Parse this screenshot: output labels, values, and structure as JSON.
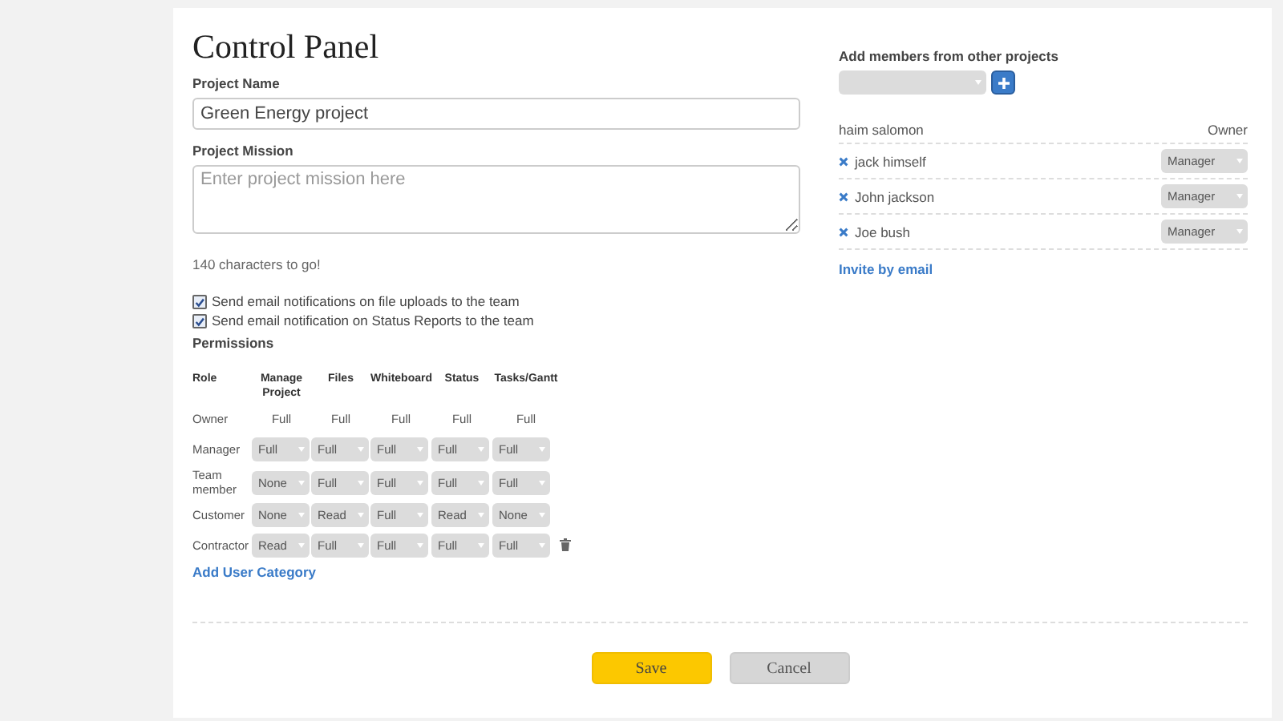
{
  "title": "Control Panel",
  "project_name": {
    "label": "Project Name",
    "value": "Green Energy project"
  },
  "project_mission": {
    "label": "Project Mission",
    "placeholder": "Enter project mission here"
  },
  "char_count": "140 characters to go!",
  "notifications": [
    {
      "label": "Send email notifications on file uploads to the team",
      "checked": true
    },
    {
      "label": "Send email notification on Status Reports to the team",
      "checked": true
    }
  ],
  "permissions": {
    "title": "Permissions",
    "columns": [
      "Role",
      "Manage Project",
      "Files",
      "Whiteboard",
      "Status",
      "Tasks/Gantt"
    ],
    "rows": [
      {
        "role": "Owner",
        "kind": "fixed",
        "values": [
          "Full",
          "Full",
          "Full",
          "Full",
          "Full"
        ],
        "deletable": false
      },
      {
        "role": "Manager",
        "kind": "select",
        "values": [
          "Full",
          "Full",
          "Full",
          "Full",
          "Full"
        ],
        "deletable": false
      },
      {
        "role": "Team member",
        "kind": "select",
        "values": [
          "None",
          "Full",
          "Full",
          "Full",
          "Full"
        ],
        "deletable": false
      },
      {
        "role": "Customer",
        "kind": "select",
        "values": [
          "None",
          "Read",
          "Full",
          "Read",
          "None"
        ],
        "deletable": false
      },
      {
        "role": "Contractor",
        "kind": "select",
        "values": [
          "Read",
          "Full",
          "Full",
          "Full",
          "Full"
        ],
        "deletable": true
      }
    ],
    "add_link": "Add User Category"
  },
  "members": {
    "title": "Add members from other projects",
    "owner": {
      "name": "haim salomon",
      "role": "Owner"
    },
    "list": [
      {
        "name": "jack himself",
        "role": "Manager"
      },
      {
        "name": "John jackson",
        "role": "Manager"
      },
      {
        "name": "Joe bush",
        "role": "Manager"
      }
    ],
    "invite_link": "Invite by email"
  },
  "buttons": {
    "save": "Save",
    "cancel": "Cancel"
  }
}
